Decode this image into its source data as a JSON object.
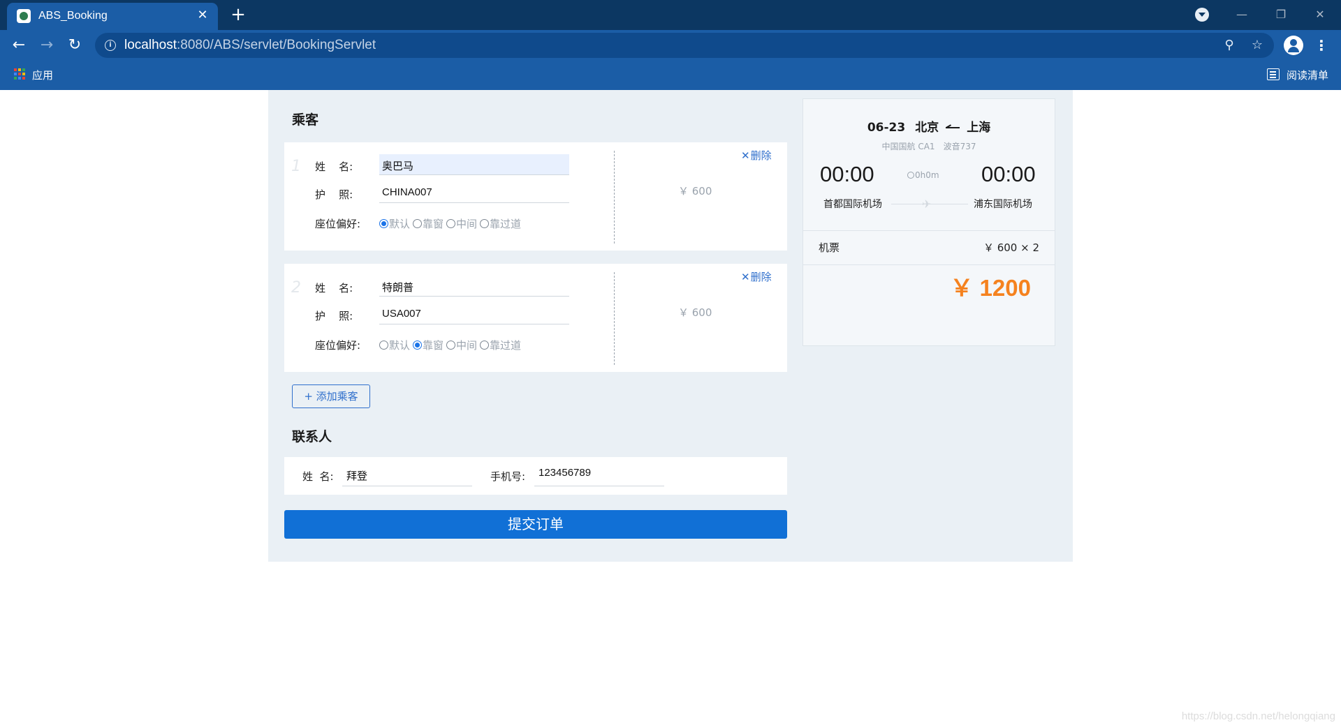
{
  "browser": {
    "tab_title": "ABS_Booking",
    "tab_close": "✕",
    "new_tab": "+",
    "url_host": "localhost",
    "url_path": ":8080/ABS/servlet/BookingServlet",
    "bookmarks_apps": "应用",
    "reading_list": "阅读清单",
    "window_controls": {
      "minimize": "—",
      "restore": "❐",
      "close": "✕"
    }
  },
  "passengers_title": "乘客",
  "labels": {
    "name": "姓    名:",
    "passport": "护    照:",
    "seat": "座位偏好:",
    "delete": "删除",
    "delete_x": "✕"
  },
  "seat_options": [
    "默认",
    "靠窗",
    "中间",
    "靠过道"
  ],
  "passengers": [
    {
      "index": "1",
      "name": "奥巴马",
      "passport": "CHINA007",
      "seat_selected": "默认",
      "price": "￥ 600"
    },
    {
      "index": "2",
      "name": "特朗普",
      "passport": "USA007",
      "seat_selected": "靠窗",
      "price": "￥ 600"
    }
  ],
  "add_passenger": "+ 添加乘客",
  "contact": {
    "title": "联系人",
    "name_label": "姓  名:",
    "name_value": "拜登",
    "phone_label": "手机号:",
    "phone_value": "123456789"
  },
  "submit": "提交订单",
  "summary": {
    "date": "06-23",
    "from_city": "北京",
    "to_city": "上海",
    "airline_flight": "中国国航 CA1",
    "aircraft": "波音737",
    "depart_time": "00:00",
    "arrive_time": "00:00",
    "duration": "0h0m",
    "from_airport": "首都国际机场",
    "to_airport": "浦东国际机场",
    "ticket_label": "机票",
    "ticket_price": "￥ 600 × 2",
    "total": "￥ 1200"
  },
  "watermark": "https://blog.csdn.net/helongqiang",
  "colors": {
    "accent": "#1170d6",
    "total": "#f5821f",
    "tab_bar": "#0c3762",
    "toolbar": "#1b5da6",
    "page_bg": "#eaf0f5"
  }
}
